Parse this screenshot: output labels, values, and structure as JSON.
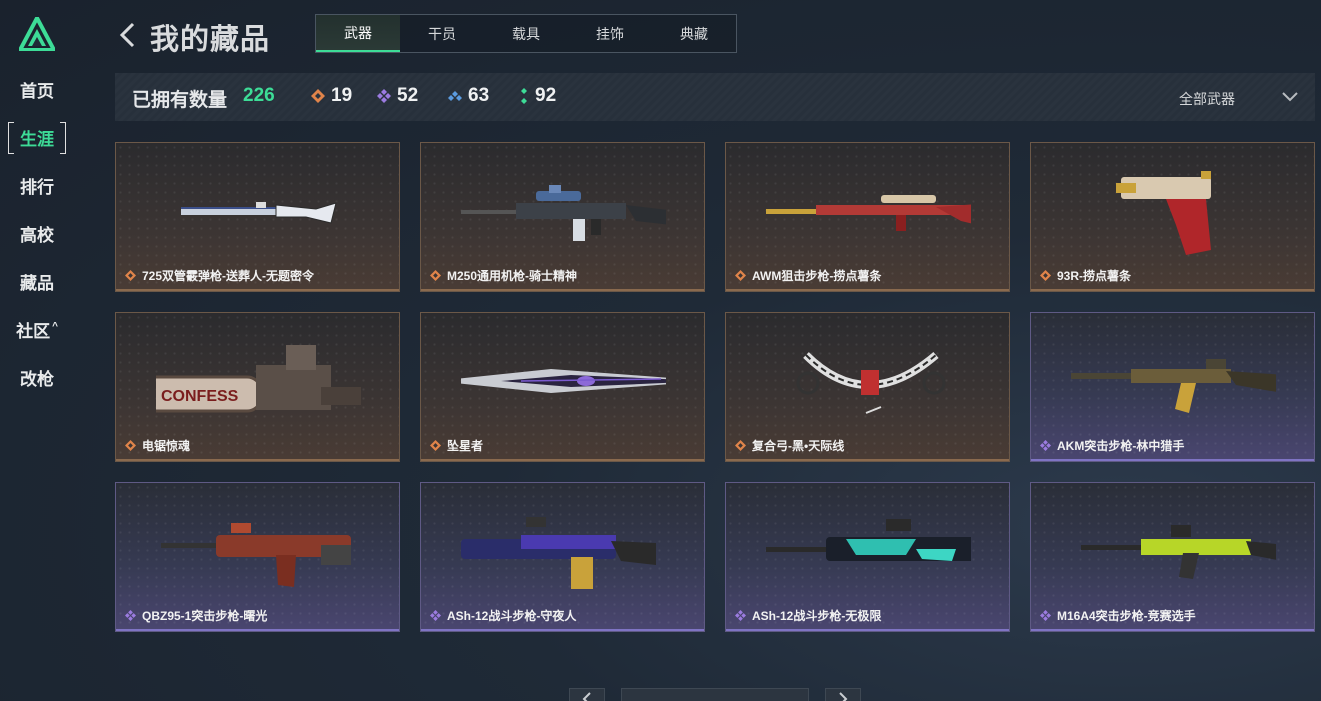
{
  "sidebar": {
    "items": [
      {
        "label": "首页"
      },
      {
        "label": "生涯"
      },
      {
        "label": "排行"
      },
      {
        "label": "高校"
      },
      {
        "label": "藏品"
      },
      {
        "label": "社区"
      },
      {
        "label": "改枪"
      }
    ],
    "active_index": 1
  },
  "header": {
    "title": "我的藏品",
    "tabs": [
      {
        "label": "武器"
      },
      {
        "label": "干员"
      },
      {
        "label": "载具"
      },
      {
        "label": "挂饰"
      },
      {
        "label": "典藏"
      }
    ],
    "active_tab": 0
  },
  "stats": {
    "owned_label": "已拥有数量",
    "owned_count": "226",
    "rarities": [
      {
        "icon": "orange-diamond-icon",
        "color": "#e0844a",
        "count": "19"
      },
      {
        "icon": "purple-diamond-icon",
        "color": "#9b7be0",
        "count": "52"
      },
      {
        "icon": "blue-diamond-icon",
        "color": "#5b9be0",
        "count": "63"
      },
      {
        "icon": "green-diamond-icon",
        "color": "#3ddc97",
        "count": "92"
      }
    ],
    "filter_label": "全部武器"
  },
  "cards": [
    {
      "name": "725双管霰弹枪-送葬人-无题密令",
      "rarity": "orange"
    },
    {
      "name": "M250通用机枪-骑士精神",
      "rarity": "orange"
    },
    {
      "name": "AWM狙击步枪-捞点薯条",
      "rarity": "orange"
    },
    {
      "name": "93R-捞点薯条",
      "rarity": "orange"
    },
    {
      "name": "电锯惊魂",
      "rarity": "orange"
    },
    {
      "name": "坠星者",
      "rarity": "orange"
    },
    {
      "name": "复合弓-黑•天际线",
      "rarity": "orange"
    },
    {
      "name": "AKM突击步枪-林中猎手",
      "rarity": "purple"
    },
    {
      "name": "QBZ95-1突击步枪-曙光",
      "rarity": "purple"
    },
    {
      "name": "ASh-12战斗步枪-守夜人",
      "rarity": "purple"
    },
    {
      "name": "ASh-12战斗步枪-无极限",
      "rarity": "purple"
    },
    {
      "name": "M16A4突击步枪-竞赛选手",
      "rarity": "purple"
    }
  ],
  "colors": {
    "accent": "#3ddc97",
    "orange_rarity": "#e0844a",
    "purple_rarity": "#9b7be0"
  }
}
